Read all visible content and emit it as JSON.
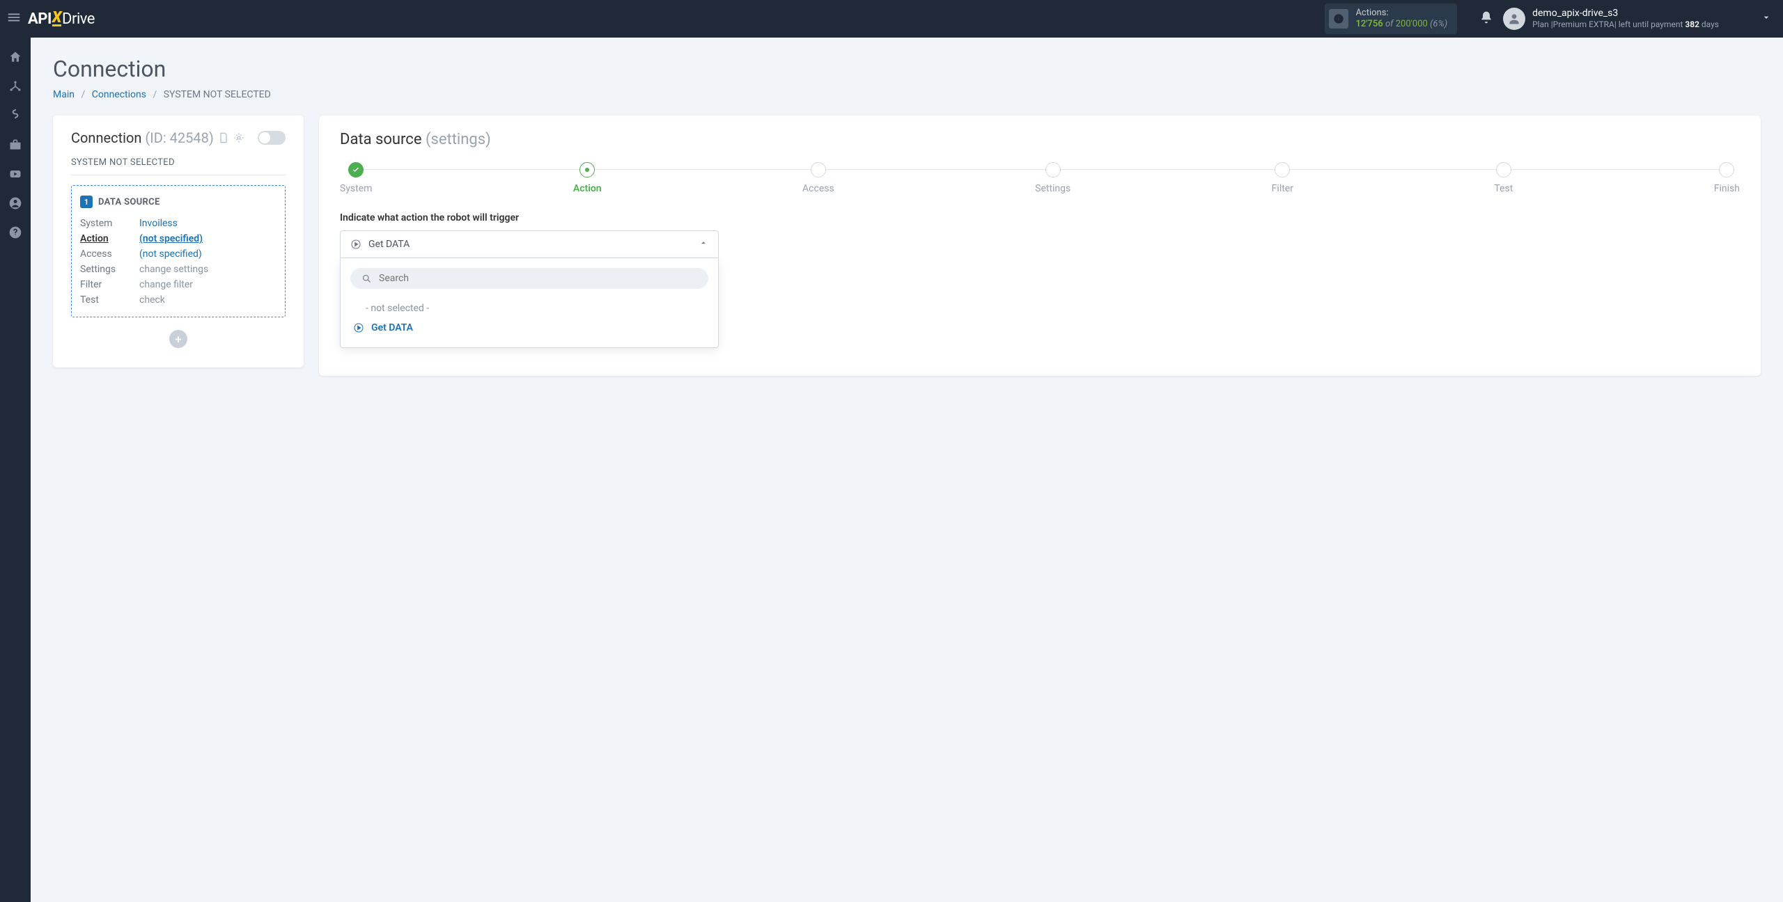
{
  "header": {
    "logo": {
      "api": "API",
      "x": "X",
      "drive": "Drive"
    },
    "actions_label": "Actions:",
    "actions_used": "12'756",
    "actions_of": "of",
    "actions_total": "200'000",
    "actions_pct": "(6%)",
    "user_name": "demo_apix-drive_s3",
    "plan_prefix": "Plan |",
    "plan_name": "Premium EXTRA",
    "plan_mid": "| left until payment ",
    "plan_days": "382",
    "plan_suffix": " days"
  },
  "page": {
    "title": "Connection",
    "crumb_main": "Main",
    "crumb_conn": "Connections",
    "crumb_current": "SYSTEM NOT SELECTED"
  },
  "conn_card": {
    "title": "Connection",
    "id_label": "(ID: 42548)",
    "subtitle": "SYSTEM NOT SELECTED",
    "badge": "1",
    "ds_title": "DATA SOURCE",
    "rows": {
      "system_k": "System",
      "system_v": "Invoiless",
      "action_k": "Action",
      "action_v": "(not specified)",
      "access_k": "Access",
      "access_v": "(not specified)",
      "settings_k": "Settings",
      "settings_v": "change settings",
      "filter_k": "Filter",
      "filter_v": "change filter",
      "test_k": "Test",
      "test_v": "check"
    },
    "add": "+"
  },
  "right": {
    "title": "Data source",
    "subtitle": "(settings)",
    "steps": [
      "System",
      "Action",
      "Access",
      "Settings",
      "Filter",
      "Test",
      "Finish"
    ],
    "field_label": "Indicate what action the robot will trigger",
    "selected": "Get DATA",
    "search_placeholder": "Search",
    "opt_none": "- not selected -",
    "opt_get": "Get DATA"
  }
}
